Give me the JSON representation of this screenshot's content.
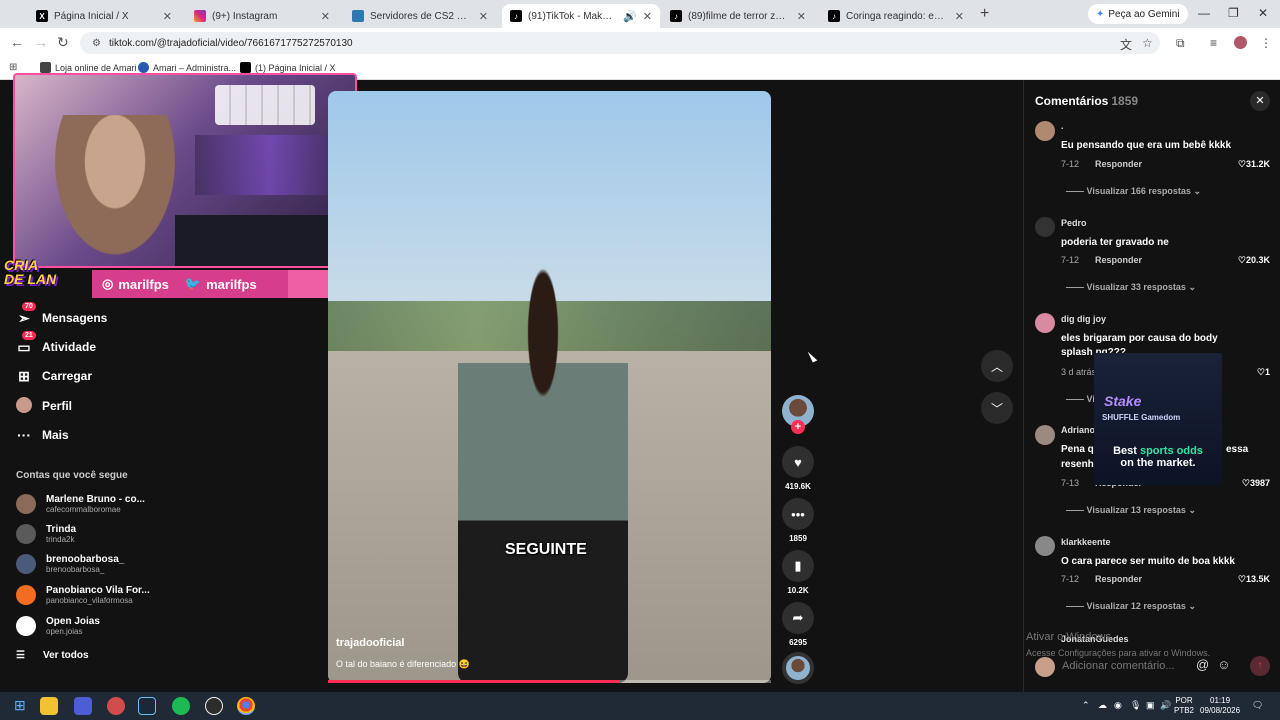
{
  "browser": {
    "tabs": [
      {
        "label": "Página Inicial / X",
        "icon": "x-icon"
      },
      {
        "label": "(9+) Instagram",
        "icon": "instagram-icon"
      },
      {
        "label": "Servidores de CS2 Disponíveis",
        "icon": "globe-icon"
      },
      {
        "label": "(91)TikTok - Make Your Day",
        "icon": "tiktok-icon"
      },
      {
        "label": "(89)filme de terror ze vitor e ra",
        "icon": "tiktok-icon"
      },
      {
        "label": "Coringa reagindo: eu com 7 ac",
        "icon": "tiktok-icon"
      }
    ],
    "gemini_label": "Peça ao Gemini",
    "url": "tiktok.com/@trajadoficial/video/7661671775272570130",
    "bookmarks": [
      "Loja online de Amari",
      "Amari – Administra...",
      "(1) Página Inicial / X"
    ]
  },
  "stream_overlay": {
    "instagram_handle": "marilfps",
    "twitter_handle": "marilfps",
    "logo_line1": "CRIA",
    "logo_line2": "DE LAN"
  },
  "sidebar": {
    "items": [
      {
        "label": "Mensagens",
        "badge": "70"
      },
      {
        "label": "Atividade",
        "badge": "21"
      },
      {
        "label": "Carregar",
        "badge": ""
      },
      {
        "label": "Perfil",
        "badge": ""
      },
      {
        "label": "Mais",
        "badge": ""
      }
    ],
    "following_title": "Contas que você segue",
    "following": [
      {
        "name": "Marlene Bruno - co...",
        "handle": "cafecommalboromae",
        "color": "#8a6a5a"
      },
      {
        "name": "Trinda",
        "handle": "trinda2k",
        "color": "#5a5a5a"
      },
      {
        "name": "brenoobarbosa_",
        "handle": "brenoobarbosa_",
        "color": "#4a5a7a"
      },
      {
        "name": "Panobianco Vila For...",
        "handle": "panobianco_vilaformosa",
        "color": "#f26d21"
      },
      {
        "name": "Open Joias",
        "handle": "open.joias",
        "color": "#ffffff"
      }
    ],
    "see_all": "Ver todos"
  },
  "video": {
    "caption": "SEGUINTE",
    "username": "trajadooficial",
    "description": "O tal do baiano é diferenciado 😆",
    "progress": 0.66,
    "likes": "419.6K",
    "comments": "1859",
    "saves": "10.2K",
    "shares": "6295"
  },
  "comments_panel": {
    "title": "Comentários",
    "count": "1859",
    "items": [
      {
        "name": ".",
        "text": "Eu pensando que era um bebê kkkk",
        "date": "7-12",
        "reply": "Responder",
        "likes": "31.2K",
        "replies": "Visualizar 166 respostas",
        "color": "#b08a70"
      },
      {
        "name": "Pedro",
        "text": "poderia ter gravado ne",
        "date": "7-12",
        "reply": "Responder",
        "likes": "20.3K",
        "replies": "Visualizar 33 respostas",
        "color": "#333333"
      },
      {
        "name": "dig dig joy",
        "text": "eles brigaram por causa do body splash pq???",
        "date": "3 d atrás",
        "reply": "",
        "likes": "1",
        "replies": "Vi",
        "color": "#d88aa0"
      },
      {
        "name": "Adriano",
        "text": "Pena q",
        "text2": "essa",
        "text3": "resenh",
        "date": "7-13",
        "reply": "Responder",
        "likes": "3987",
        "replies": "Visualizar 13 respostas",
        "color": "#9a8a80"
      },
      {
        "name": "klarkkeente",
        "text": "O cara parece ser muito de boa kkkk",
        "date": "7-12",
        "reply": "Responder",
        "likes": "13.5K",
        "replies": "Visualizar 12 respostas",
        "color": "#888888"
      }
    ],
    "partial_name": "JonatanGuedes",
    "ad": {
      "brand": "SHUFFLE  Gamedom",
      "logo": "Stake",
      "line_a": "Best ",
      "line_highlight": "sports odds",
      "line_b": "on the market."
    },
    "activate_1": "Ativar o Windows",
    "activate_2": "Acesse Configurações para ativar o Windows.",
    "add_placeholder": "Adicionar comentário..."
  },
  "taskbar": {
    "lang_1": "POR",
    "lang_2": "PTB2",
    "time": "01:19",
    "date": "09/08/2026"
  }
}
